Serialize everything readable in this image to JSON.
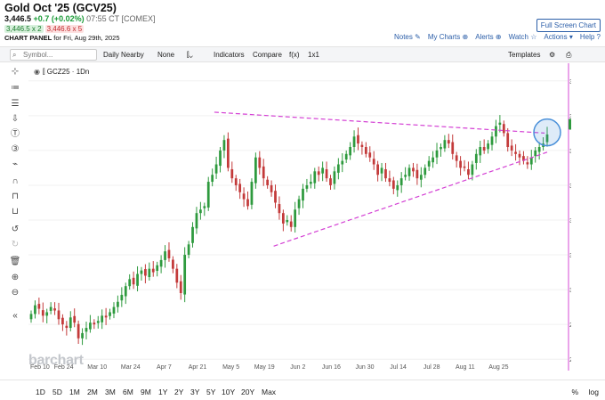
{
  "header": {
    "title": "Gold Oct '25 (GCV25)",
    "last": "3,446.5",
    "change": "+0.7 (+0.02%)",
    "meta": "07:55 CT [COMEX]",
    "bid": "3,446.5 x 2",
    "ask": "3,446.6 x 5",
    "panel_label": "CHART PANEL",
    "panel_date": "for Fri, Aug 29th, 2025",
    "fullscreen": "Full Screen Chart",
    "links": [
      "Notes",
      "My Charts",
      "Alerts",
      "Watch",
      "Actions",
      "Help"
    ]
  },
  "toolbar": {
    "symbol_placeholder": "Symbol...",
    "items": [
      "Daily Nearby",
      "None",
      "Indicators",
      "Compare",
      "f(x)",
      "1x1",
      "Templates"
    ]
  },
  "legend": {
    "symbol": "GCZ25",
    "interval": "1Dn"
  },
  "watermark": "barchart",
  "ranges": [
    "1D",
    "5D",
    "1M",
    "2M",
    "3M",
    "6M",
    "9M",
    "1Y",
    "2Y",
    "3Y",
    "5Y",
    "10Y",
    "20Y",
    "Max"
  ],
  "scale_options": {
    "percent": "%",
    "log": "log"
  },
  "colors": {
    "up": "#2e9a3e",
    "down": "#c33a3a",
    "trend": "#d440d4",
    "price_tag": "#2e9a3e",
    "highlight": "#4a90d9"
  },
  "chart_data": {
    "type": "candlestick",
    "x_tick_labels": [
      "Feb 10",
      "Feb 24",
      "Mar 10",
      "Mar 24",
      "Apr 7",
      "Apr 21",
      "May 5",
      "May 19",
      "Jun 2",
      "Jun 16",
      "Jun 30",
      "Jul 14",
      "Jul 28",
      "Aug 11",
      "Aug 25"
    ],
    "y_tick_labels": [
      "3,600.0",
      "3,500.0",
      "3,400.0",
      "3,300.0",
      "3,200.0",
      "3,100.0",
      "3,000.0",
      "2,900.0",
      "2,800.0"
    ],
    "ylim": [
      2780,
      3620
    ],
    "last_price_label": "3,475.2",
    "trendlines": [
      {
        "start": [
          "2025-04-22",
          3510
        ],
        "end": [
          "2025-08-28",
          3450
        ]
      },
      {
        "start": [
          "2025-05-15",
          3125
        ],
        "end": [
          "2025-08-29",
          3395
        ]
      }
    ],
    "closes": [
      2930,
      2955,
      2945,
      2925,
      2935,
      2950,
      2940,
      2915,
      2900,
      2890,
      2920,
      2905,
      2860,
      2875,
      2890,
      2905,
      2900,
      2910,
      2925,
      2920,
      2935,
      2950,
      2965,
      2985,
      3010,
      3030,
      3015,
      3045,
      3055,
      3040,
      3060,
      3050,
      3070,
      3085,
      3110,
      3090,
      3060,
      3020,
      2990,
      3100,
      3130,
      3180,
      3220,
      3230,
      3240,
      3310,
      3330,
      3360,
      3400,
      3430,
      3350,
      3320,
      3300,
      3280,
      3260,
      3240,
      3310,
      3380,
      3350,
      3320,
      3300,
      3280,
      3250,
      3220,
      3190,
      3200,
      3180,
      3230,
      3260,
      3290,
      3300,
      3310,
      3340,
      3330,
      3350,
      3320,
      3300,
      3340,
      3360,
      3370,
      3390,
      3410,
      3440,
      3420,
      3410,
      3390,
      3380,
      3360,
      3330,
      3350,
      3320,
      3310,
      3290,
      3300,
      3320,
      3330,
      3350,
      3340,
      3320,
      3330,
      3350,
      3370,
      3380,
      3400,
      3410,
      3430,
      3420,
      3390,
      3370,
      3350,
      3350,
      3330,
      3360,
      3390,
      3410,
      3400,
      3420,
      3440,
      3470,
      3480,
      3450,
      3410,
      3400,
      3390,
      3380,
      3370,
      3360,
      3380,
      3400,
      3410,
      3420,
      3446
    ]
  }
}
